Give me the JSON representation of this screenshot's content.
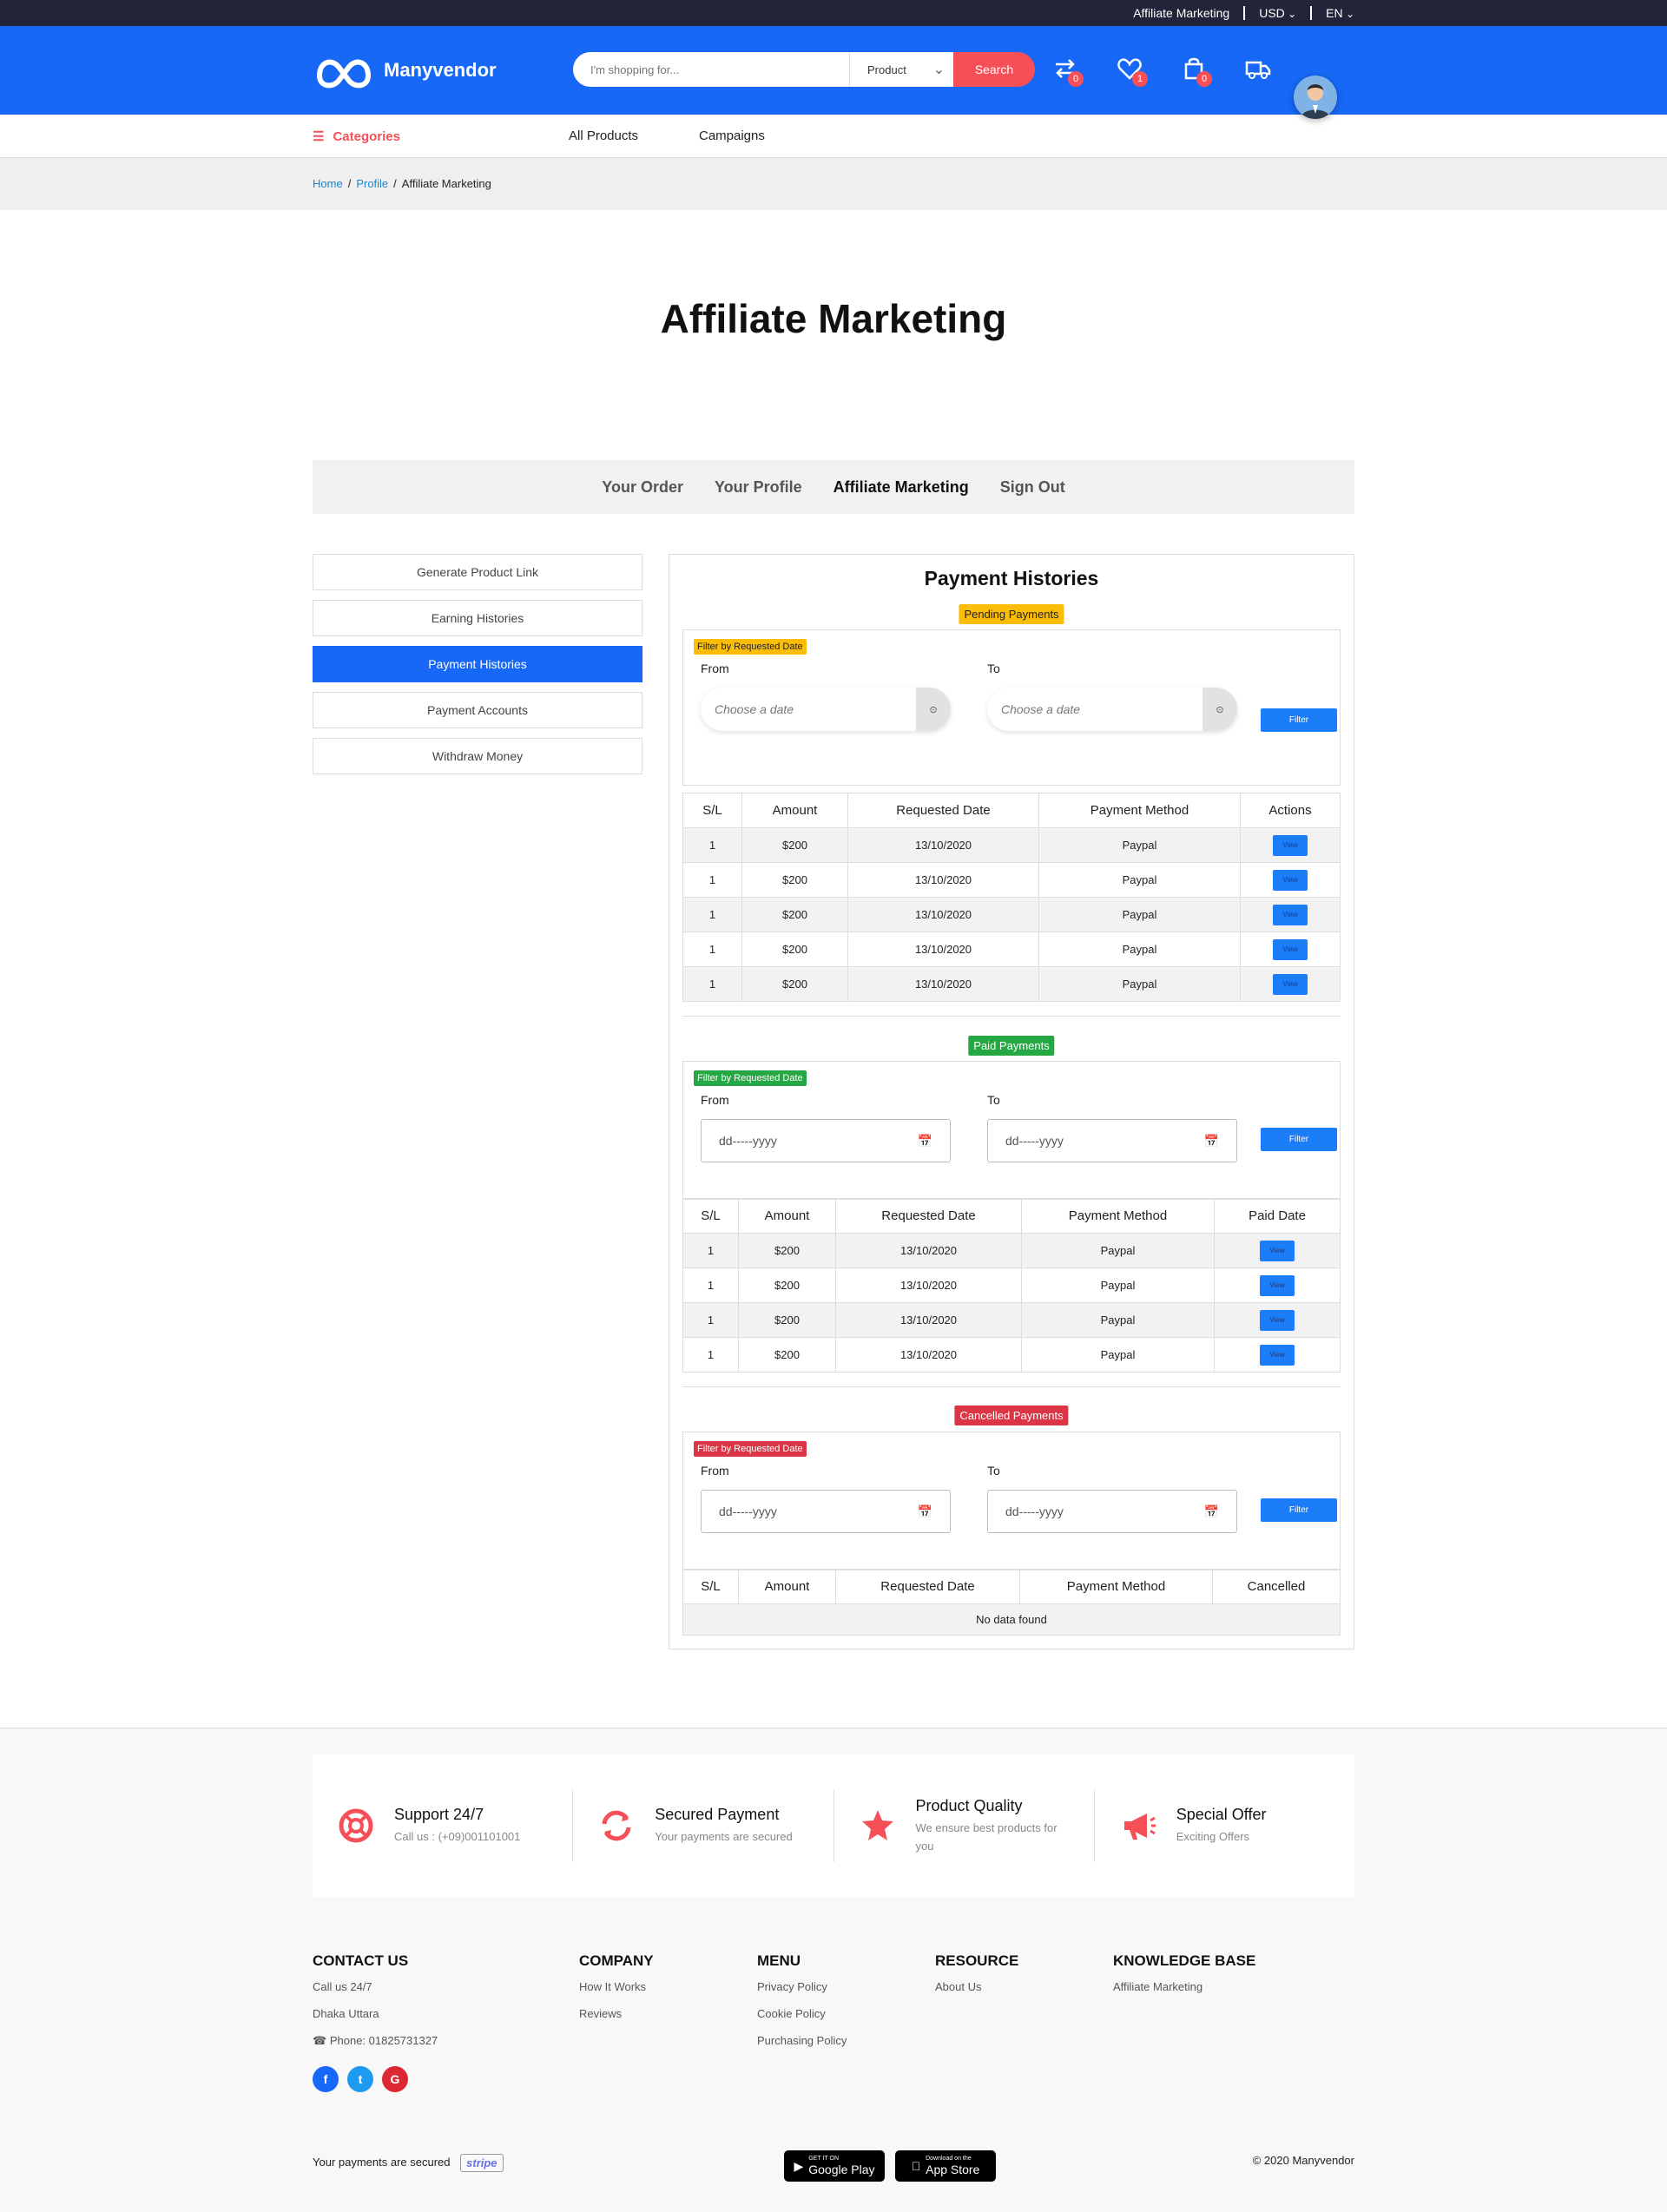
{
  "topbar": {
    "affiliate": "Affiliate Marketing",
    "currency": "USD",
    "language": "EN"
  },
  "header": {
    "brand": "Manyvendor",
    "search_placeholder": "I'm shopping for...",
    "search_category": "Product",
    "search_button": "Search",
    "compare_count": "0",
    "wishlist_count": "1",
    "cart_count": "0"
  },
  "nav": {
    "categories": "Categories",
    "all_products": "All Products",
    "campaigns": "Campaigns"
  },
  "breadcrumb": {
    "home": "Home",
    "profile": "Profile",
    "current": "Affiliate Marketing"
  },
  "page_title": "Affiliate Marketing",
  "tabs": [
    "Your Order",
    "Your Profile",
    "Affiliate Marketing",
    "Sign Out"
  ],
  "sidebar": [
    "Generate Product Link",
    "Earning Histories",
    "Payment Histories",
    "Payment Accounts",
    "Withdraw Money"
  ],
  "panel": {
    "title": "Payment Histories",
    "filter_tag": "Filter by Requested Date",
    "from": "From",
    "to": "To",
    "filter_button": "Filter",
    "date_placeholder": "Choose a date",
    "date_input_placeholder": "dd-----yyyy",
    "view_label": "View",
    "pending": {
      "label": "Pending Payments",
      "headers": [
        "S/L",
        "Amount",
        "Requested Date",
        "Payment Method",
        "Actions"
      ],
      "rows": [
        [
          "1",
          "$200",
          "13/10/2020",
          "Paypal"
        ],
        [
          "1",
          "$200",
          "13/10/2020",
          "Paypal"
        ],
        [
          "1",
          "$200",
          "13/10/2020",
          "Paypal"
        ],
        [
          "1",
          "$200",
          "13/10/2020",
          "Paypal"
        ],
        [
          "1",
          "$200",
          "13/10/2020",
          "Paypal"
        ]
      ]
    },
    "paid": {
      "label": "Paid Payments",
      "headers": [
        "S/L",
        "Amount",
        "Requested Date",
        "Payment Method",
        "Paid Date"
      ],
      "rows": [
        [
          "1",
          "$200",
          "13/10/2020",
          "Paypal"
        ],
        [
          "1",
          "$200",
          "13/10/2020",
          "Paypal"
        ],
        [
          "1",
          "$200",
          "13/10/2020",
          "Paypal"
        ],
        [
          "1",
          "$200",
          "13/10/2020",
          "Paypal"
        ]
      ]
    },
    "cancelled": {
      "label": "Cancelled Payments",
      "headers": [
        "S/L",
        "Amount",
        "Requested Date",
        "Payment Method",
        "Cancelled"
      ],
      "empty": "No data found"
    }
  },
  "features": [
    {
      "title": "Support 24/7",
      "sub": "Call us : (+09)001101001",
      "icon": "lifebuoy-icon"
    },
    {
      "title": "Secured Payment",
      "sub": "Your payments are secured",
      "icon": "refresh-icon"
    },
    {
      "title": "Product Quality",
      "sub": "We ensure best products for you",
      "icon": "star-icon"
    },
    {
      "title": "Special Offer",
      "sub": "Exciting Offers",
      "icon": "megaphone-icon"
    }
  ],
  "footer": {
    "contact": {
      "title": "CONTACT US",
      "lines": [
        "Call us 24/7",
        "Dhaka Uttara"
      ],
      "phone": "Phone: 01825731327"
    },
    "company": {
      "title": "COMPANY",
      "links": [
        "How It Works",
        "Reviews"
      ]
    },
    "menu": {
      "title": "MENU",
      "links": [
        "Privacy Policy",
        "Cookie Policy",
        "Purchasing Policy"
      ]
    },
    "resource": {
      "title": "RESOURCE",
      "links": [
        "About Us"
      ]
    },
    "knowledge": {
      "title": "KNOWLEDGE BASE",
      "links": [
        "Affiliate Marketing"
      ]
    },
    "secure_text": "Your payments are secured",
    "stripe": "stripe",
    "google_play_small": "GET IT ON",
    "google_play": "Google Play",
    "app_store_small": "Download on the",
    "app_store": "App Store",
    "copyright": "© 2020 Manyvendor"
  },
  "colors": {
    "primary": "#1768f6",
    "accent": "#f74f57",
    "topbar": "#23233a",
    "pending": "#fbbd08",
    "paid": "#25a844",
    "cancelled": "#dc3545"
  }
}
